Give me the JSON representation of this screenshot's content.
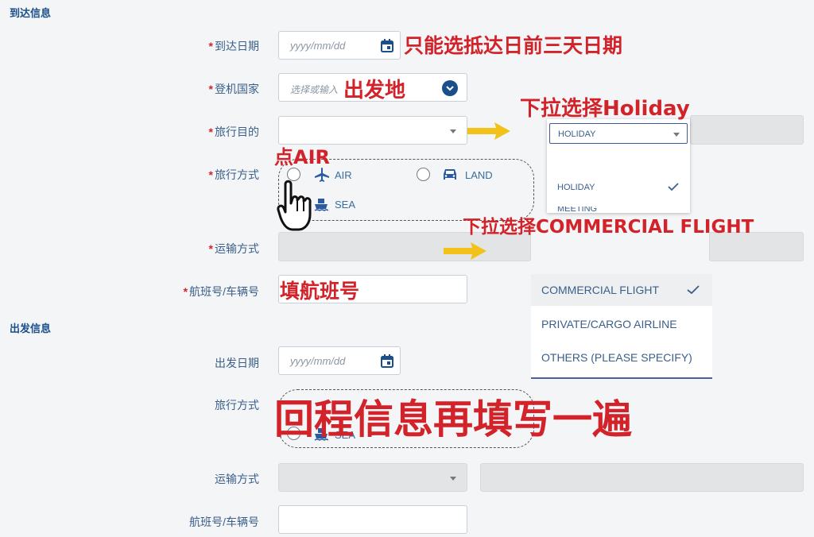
{
  "arrival": {
    "section_title": "到达信息",
    "date": {
      "label": "到达日期",
      "placeholder": "yyyy/mm/dd"
    },
    "country": {
      "label": "登机国家",
      "placeholder": "选择或输入"
    },
    "purpose": {
      "label": "旅行目的",
      "value": ""
    },
    "mode": {
      "label": "旅行方式",
      "options": [
        "AIR",
        "LAND",
        "SEA"
      ]
    },
    "transport": {
      "label": "运输方式"
    },
    "flight": {
      "label": "航班号/车辆号"
    }
  },
  "departure": {
    "section_title": "出发信息",
    "date": {
      "label": "出发日期",
      "placeholder": "yyyy/mm/dd"
    },
    "mode": {
      "label": "旅行方式",
      "options": [
        "SEA"
      ]
    },
    "transport": {
      "label": "运输方式"
    },
    "flight": {
      "label": "航班号/车辆号"
    }
  },
  "purpose_dropdown": {
    "selected": "HOLIDAY",
    "items": [
      "HOLIDAY",
      "MEETING"
    ],
    "checked_item": "HOLIDAY"
  },
  "transport_dropdown": {
    "items": [
      "COMMERCIAL FLIGHT",
      "PRIVATE/CARGO AIRLINE",
      "OTHERS (PLEASE SPECIFY)"
    ],
    "checked_item": "COMMERCIAL FLIGHT"
  },
  "annotations": {
    "date_hint": "只能选抵达日前三天日期",
    "country_hint": "出发地",
    "purpose_hint": "下拉选择Holiday",
    "air_hint": "点AIR",
    "transport_hint": "下拉选择COMMERCIAL FLIGHT",
    "flight_hint": "填航班号",
    "return_hint": "回程信息再填写一遍"
  },
  "colors": {
    "accent": "#1b4f8a",
    "required": "#d2242b",
    "annotation_red": "#d2232a",
    "annotation_arrow": "#f2c21b"
  },
  "icons": [
    "calendar-icon",
    "chevron-down-icon",
    "airplane-icon",
    "car-icon",
    "ship-icon",
    "check-icon",
    "pointer-hand-icon",
    "arrow-right-icon"
  ]
}
